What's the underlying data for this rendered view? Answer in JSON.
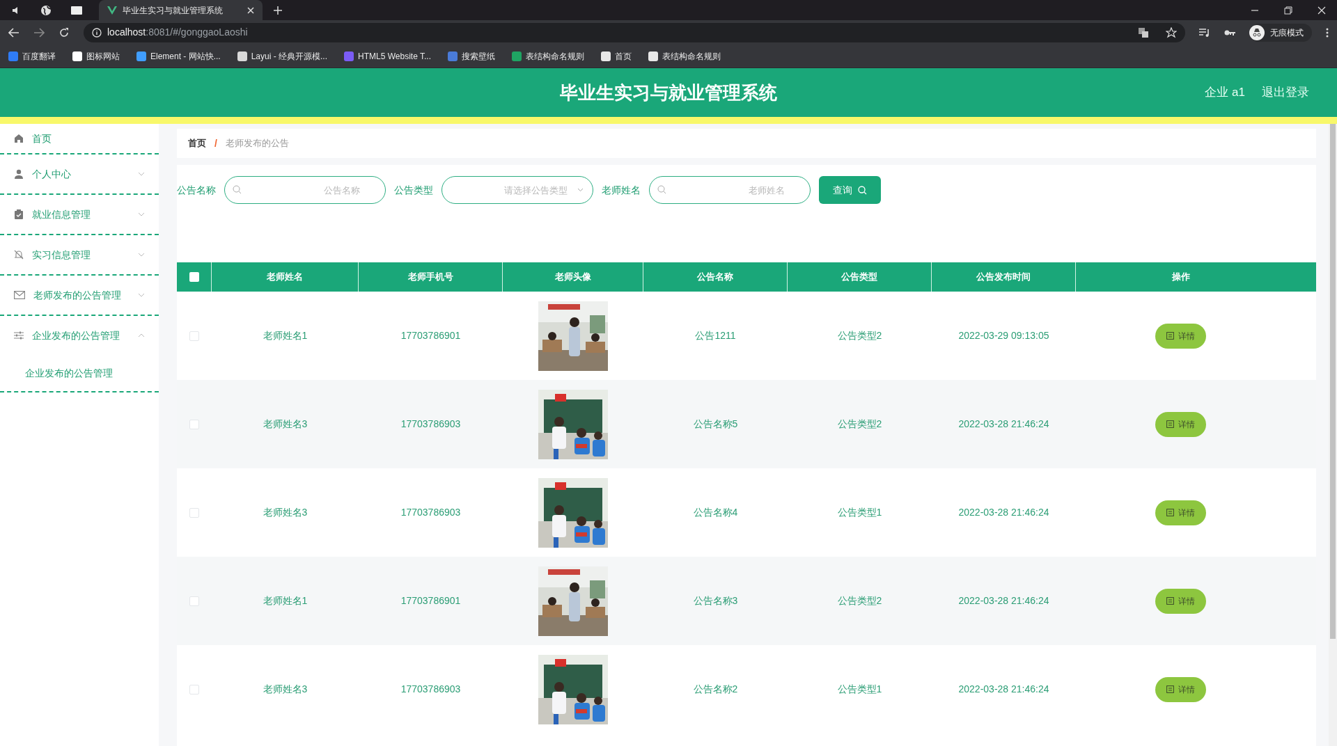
{
  "browser": {
    "tab": {
      "title": "毕业生实习与就业管理系统",
      "selected": true
    },
    "address": {
      "host": "localhost",
      "path": ":8081/#/gonggaoLaoshi"
    },
    "bookmarks": [
      {
        "label": "百度翻译",
        "color": "#2f7cf6"
      },
      {
        "label": "图标网站",
        "color": "#ffffff"
      },
      {
        "label": "Element - 网站快...",
        "color": "#409eff"
      },
      {
        "label": "Layui - 经典开源模...",
        "color": "#d9d9d9"
      },
      {
        "label": "HTML5 Website T...",
        "color": "#7b5cf5"
      },
      {
        "label": "搜索壁纸",
        "color": "#4a7bd8"
      },
      {
        "label": "表结构命名规则",
        "color": "#1fa463"
      },
      {
        "label": "首页",
        "color": "#e8e8e8"
      },
      {
        "label": "表结构命名规则",
        "color": "#e8e8e8"
      }
    ],
    "profile": "无痕模式"
  },
  "header": {
    "title": "毕业生实习与就业管理系统",
    "user": "企业 a1",
    "logout": "退出登录"
  },
  "sidebar": {
    "items": [
      {
        "label": "首页"
      },
      {
        "label": "个人中心",
        "expanded": false
      },
      {
        "label": "就业信息管理",
        "expanded": false
      },
      {
        "label": "实习信息管理",
        "expanded": false
      },
      {
        "label": "老师发布的公告管理",
        "expanded": false
      },
      {
        "label": "企业发布的公告管理",
        "expanded": true,
        "children": [
          {
            "label": "企业发布的公告管理"
          }
        ]
      }
    ]
  },
  "breadcrumb": {
    "items": [
      "首页",
      "老师发布的公告"
    ],
    "separator": "/"
  },
  "search": {
    "fields": [
      {
        "label": "公告名称",
        "placeholder": "公告名称",
        "kind": "text"
      },
      {
        "label": "公告类型",
        "placeholder": "请选择公告类型",
        "kind": "select"
      },
      {
        "label": "老师姓名",
        "placeholder": "老师姓名",
        "kind": "text"
      }
    ],
    "button": "查询"
  },
  "table": {
    "select_all": {
      "checked": false
    },
    "columns": [
      "老师姓名",
      "老师手机号",
      "老师头像",
      "公告名称",
      "公告类型",
      "公告发布时间",
      "操作"
    ],
    "rows": [
      {
        "checked": false,
        "teacher": "老师姓名1",
        "phone": "17703786901",
        "title": "公告1211",
        "type": "公告类型2",
        "time": "2022-03-29 09:13:05",
        "action": "详情"
      },
      {
        "checked": false,
        "teacher": "老师姓名3",
        "phone": "17703786903",
        "title": "公告名称5",
        "type": "公告类型2",
        "time": "2022-03-28 21:46:24",
        "action": "详情"
      },
      {
        "checked": false,
        "teacher": "老师姓名3",
        "phone": "17703786903",
        "title": "公告名称4",
        "type": "公告类型1",
        "time": "2022-03-28 21:46:24",
        "action": "详情"
      },
      {
        "checked": false,
        "teacher": "老师姓名1",
        "phone": "17703786901",
        "title": "公告名称3",
        "type": "公告类型2",
        "time": "2022-03-28 21:46:24",
        "action": "详情"
      },
      {
        "checked": false,
        "teacher": "老师姓名3",
        "phone": "17703786903",
        "title": "公告名称2",
        "type": "公告类型1",
        "time": "2022-03-28 21:46:24",
        "action": "详情"
      }
    ]
  }
}
